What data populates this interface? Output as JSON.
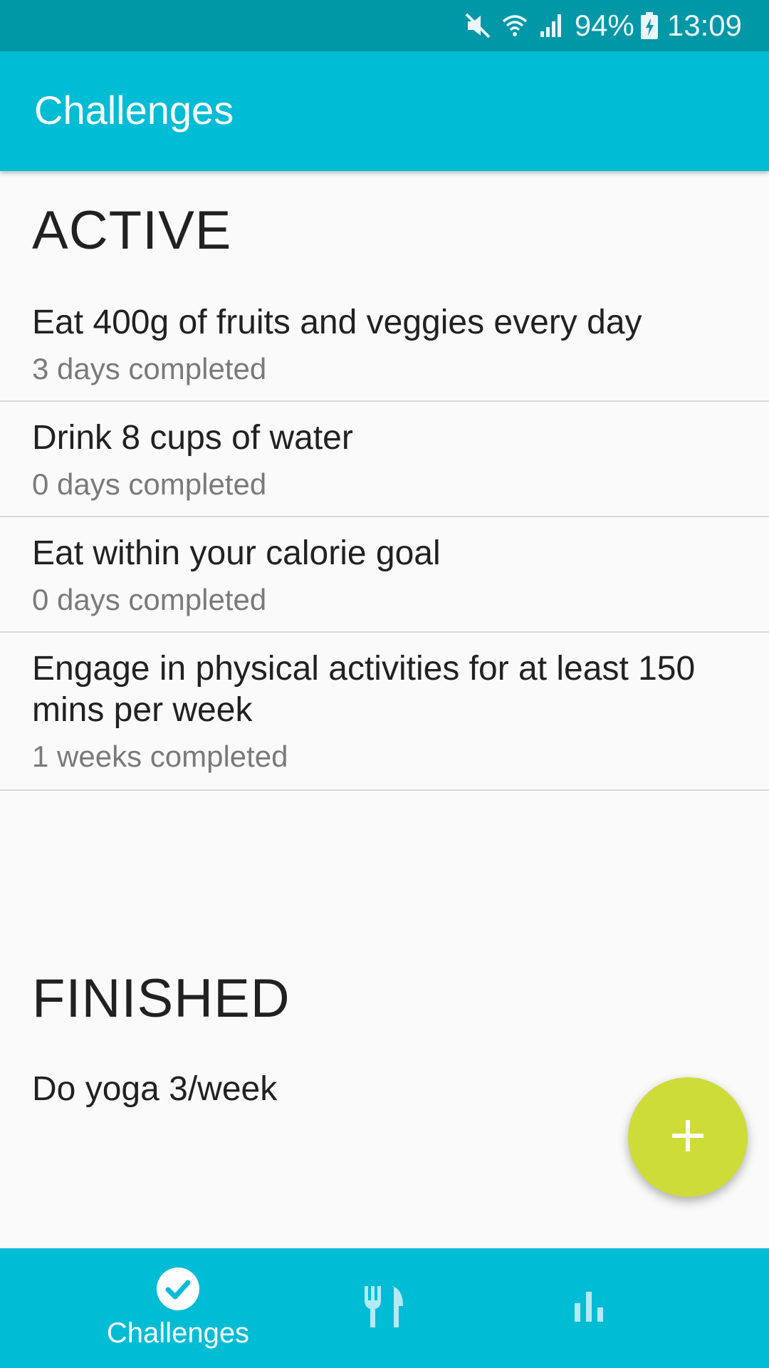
{
  "status_bar": {
    "battery": "94%",
    "time": "13:09",
    "icons": [
      "mute-icon",
      "wifi-icon",
      "signal-icon",
      "battery-charging-icon"
    ]
  },
  "app_bar": {
    "title": "Challenges"
  },
  "active": {
    "header": "ACTIVE",
    "items": [
      {
        "title": "Eat 400g of fruits and veggies every day",
        "subtitle": "3 days completed"
      },
      {
        "title": "Drink 8 cups of water",
        "subtitle": "0 days completed"
      },
      {
        "title": "Eat within your calorie goal",
        "subtitle": "0 days completed"
      },
      {
        "title": "Engage in physical activities for at least 150 mins per week",
        "subtitle": "1 weeks completed"
      }
    ]
  },
  "finished": {
    "header": "FINISHED",
    "items": [
      {
        "title": "Do yoga 3/week"
      }
    ]
  },
  "fab": {
    "icon": "plus-icon",
    "color": "#cddc39"
  },
  "bottom_nav": {
    "items": [
      {
        "label": "Challenges",
        "icon": "check-circle-icon",
        "selected": true
      },
      {
        "label": "",
        "icon": "fork-knife-icon",
        "selected": false
      },
      {
        "label": "",
        "icon": "bar-chart-icon",
        "selected": false
      }
    ]
  },
  "colors": {
    "primary": "#00bcd4",
    "primary_dark": "#0097a7",
    "accent": "#cddc39"
  }
}
